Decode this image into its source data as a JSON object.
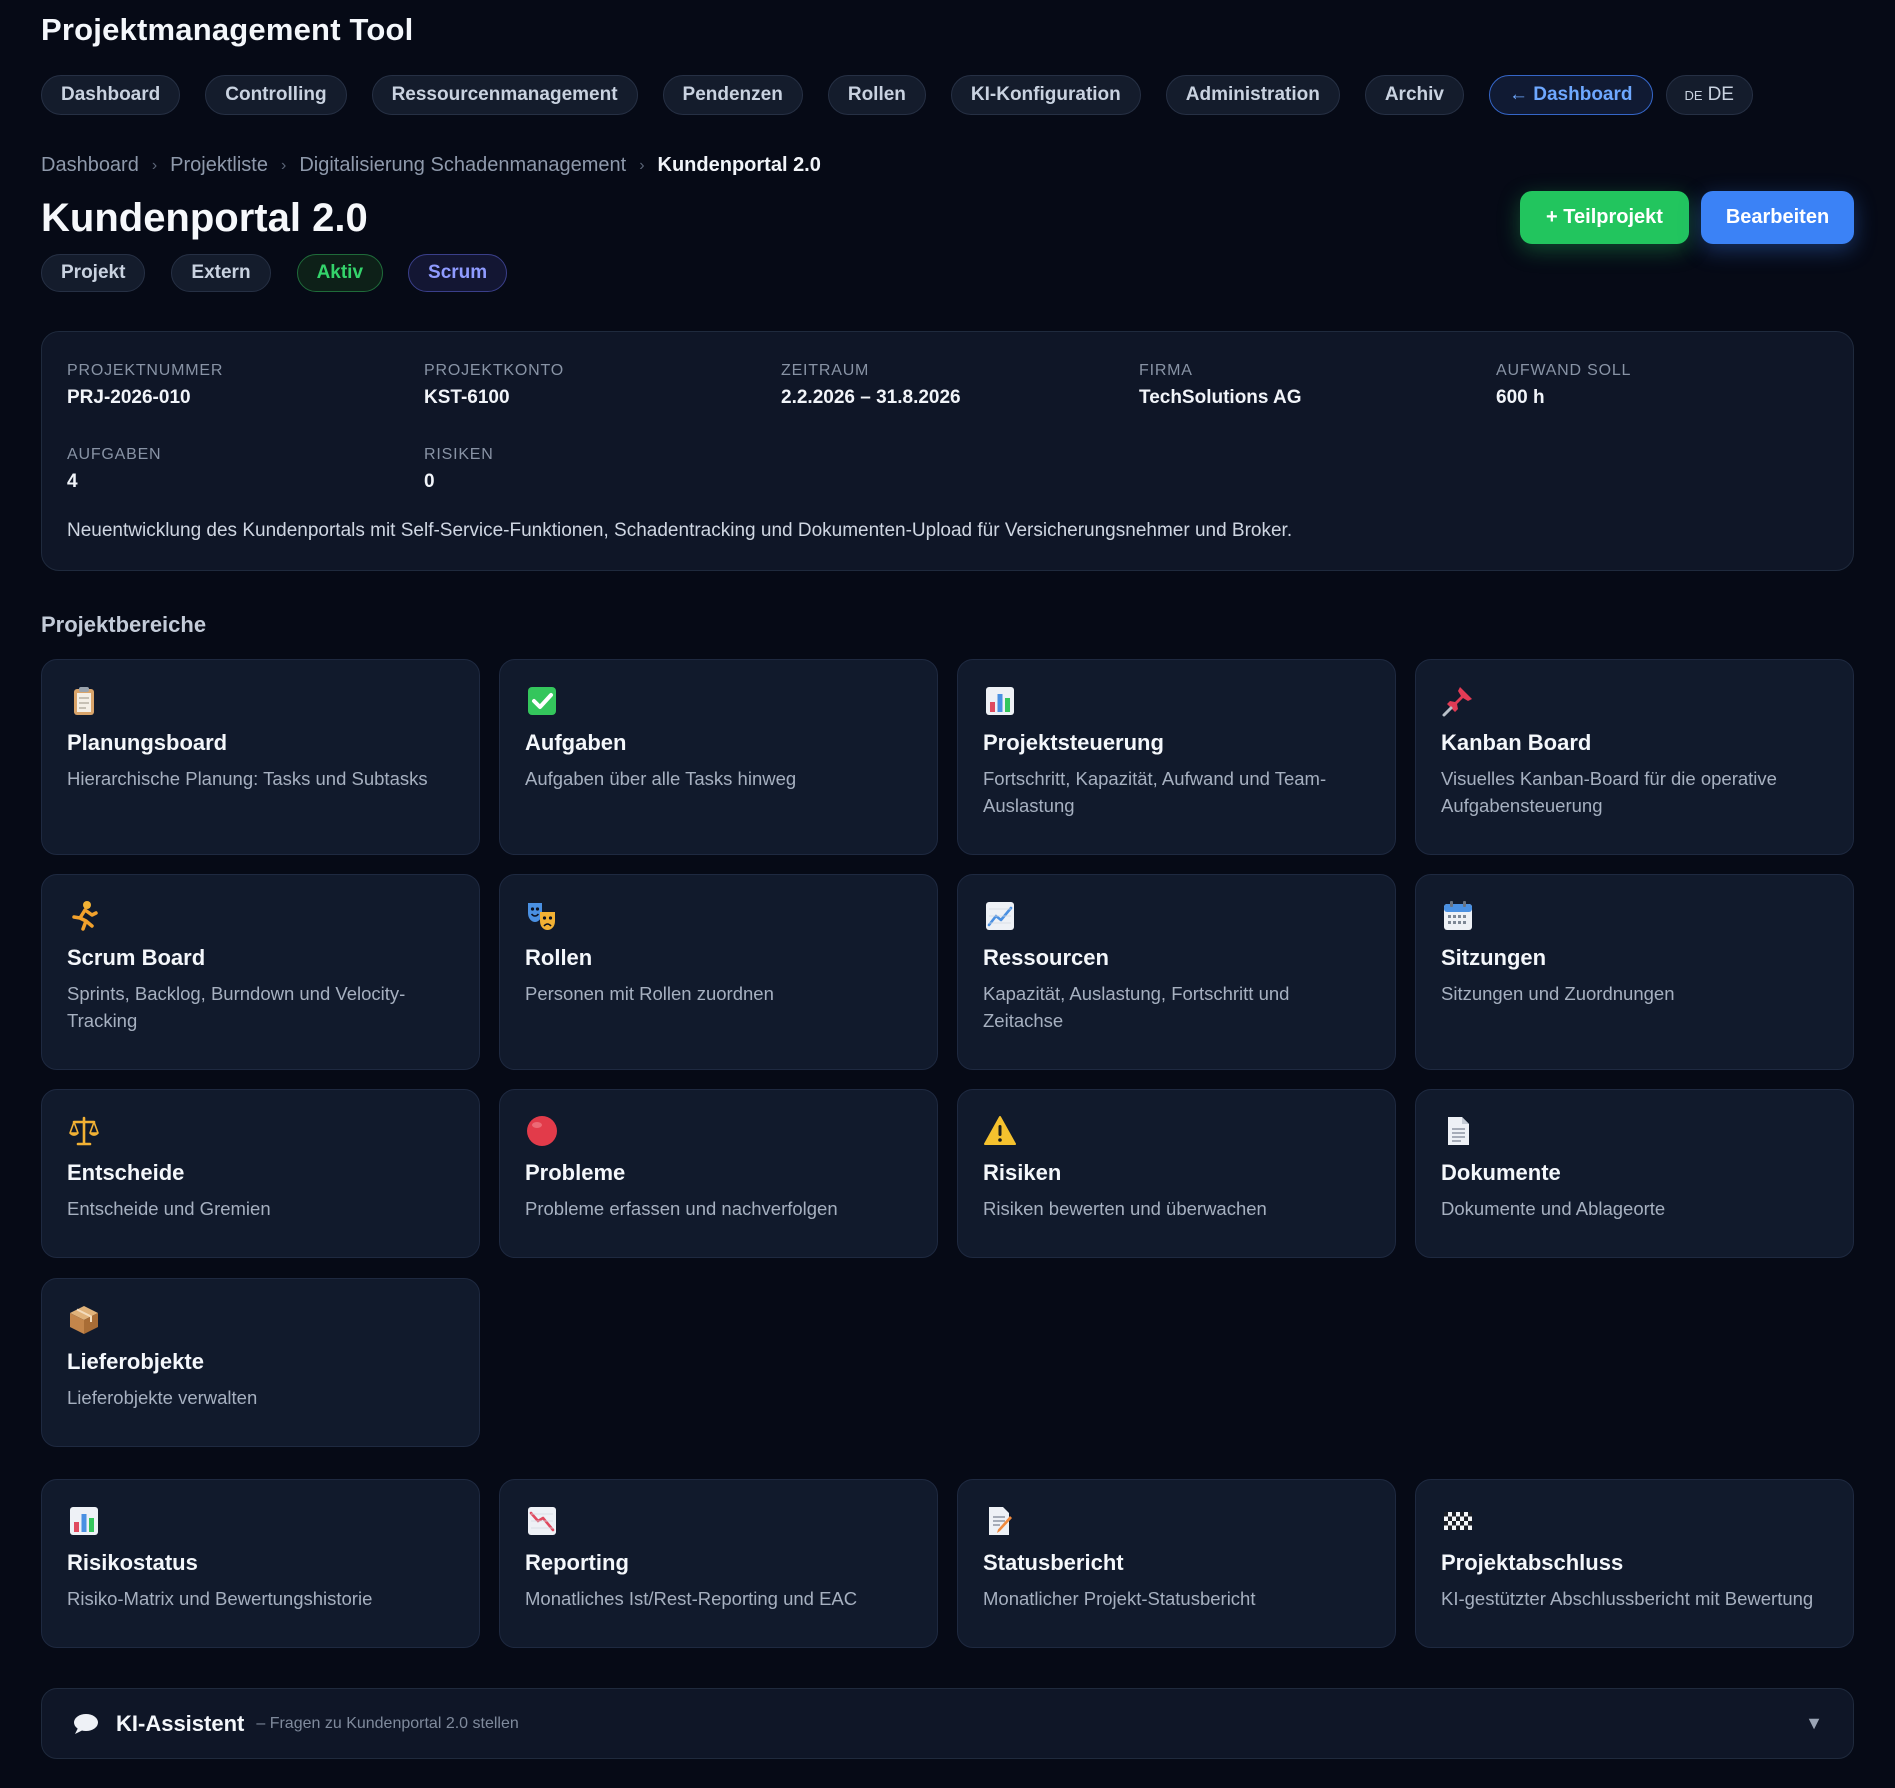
{
  "app": {
    "title": "Projektmanagement Tool"
  },
  "nav": {
    "items": [
      {
        "label": "Dashboard"
      },
      {
        "label": "Controlling"
      },
      {
        "label": "Ressourcenmanagement"
      },
      {
        "label": "Pendenzen"
      },
      {
        "label": "Rollen"
      },
      {
        "label": "KI-Konfiguration"
      },
      {
        "label": "Administration"
      },
      {
        "label": "Archiv"
      }
    ],
    "back_label": "← Dashboard",
    "lang_flag": "DE",
    "lang_label": "DE"
  },
  "breadcrumb": [
    "Dashboard",
    "Projektliste",
    "Digitalisierung Schadenmanagement",
    "Kundenportal 2.0"
  ],
  "page": {
    "title": "Kundenportal 2.0"
  },
  "actions": {
    "add_subproject": "+ Teilprojekt",
    "edit": "Bearbeiten"
  },
  "tags": [
    "Projekt",
    "Extern",
    "Aktiv",
    "Scrum"
  ],
  "info": {
    "fields": [
      {
        "label": "PROJEKTNUMMER",
        "value": "PRJ-2026-010"
      },
      {
        "label": "PROJEKTKONTO",
        "value": "KST-6100"
      },
      {
        "label": "ZEITRAUM",
        "value": "2.2.2026 – 31.8.2026"
      },
      {
        "label": "FIRMA",
        "value": "TechSolutions AG"
      },
      {
        "label": "AUFWAND SOLL",
        "value": "600 h"
      },
      {
        "label": "AUFGABEN",
        "value": "4"
      },
      {
        "label": "RISIKEN",
        "value": "0"
      }
    ],
    "description": "Neuentwicklung des Kundenportals mit Self-Service-Funktionen, Schadentracking und Dokumenten-Upload für Versicherungsnehmer und Broker."
  },
  "section_title": "Projektbereiche",
  "cards": [
    {
      "icon": "clipboard-icon",
      "title": "Planungsboard",
      "desc": "Hierarchische Planung: Tasks und Subtasks"
    },
    {
      "icon": "checkmark-icon",
      "title": "Aufgaben",
      "desc": "Aufgaben über alle Tasks hinweg"
    },
    {
      "icon": "bar-chart-icon",
      "title": "Projektsteuerung",
      "desc": "Fortschritt, Kapazität, Aufwand und Team-Auslastung"
    },
    {
      "icon": "pushpin-icon",
      "title": "Kanban Board",
      "desc": "Visuelles Kanban-Board für die operative Aufgabensteuerung"
    },
    {
      "icon": "runner-icon",
      "title": "Scrum Board",
      "desc": "Sprints, Backlog, Burndown und Velocity-Tracking"
    },
    {
      "icon": "masks-icon",
      "title": "Rollen",
      "desc": "Personen mit Rollen zuordnen"
    },
    {
      "icon": "trend-chart-icon",
      "title": "Ressourcen",
      "desc": "Kapazität, Auslastung, Fortschritt und Zeitachse"
    },
    {
      "icon": "calendar-icon",
      "title": "Sitzungen",
      "desc": "Sitzungen und Zuordnungen"
    },
    {
      "icon": "scales-icon",
      "title": "Entscheide",
      "desc": "Entscheide und Gremien"
    },
    {
      "icon": "red-circle-icon",
      "title": "Probleme",
      "desc": "Probleme erfassen und nachverfolgen"
    },
    {
      "icon": "warning-icon",
      "title": "Risiken",
      "desc": "Risiken bewerten und überwachen"
    },
    {
      "icon": "document-icon",
      "title": "Dokumente",
      "desc": "Dokumente und Ablageorte"
    },
    {
      "icon": "package-icon",
      "title": "Lieferobjekte",
      "desc": "Lieferobjekte verwalten"
    },
    {
      "icon": "bar-chart-icon",
      "title": "Risikostatus",
      "desc": "Risiko-Matrix und Bewertungshistorie"
    },
    {
      "icon": "down-chart-icon",
      "title": "Reporting",
      "desc": "Monatliches Ist/Rest-Reporting und EAC"
    },
    {
      "icon": "memo-icon",
      "title": "Statusbericht",
      "desc": "Monatlicher Projekt-Statusbericht"
    },
    {
      "icon": "checkered-flag-icon",
      "title": "Projektabschluss",
      "desc": "KI-gestützter Abschlussbericht mit Bewertung"
    }
  ],
  "ki": {
    "title": "KI-Assistent",
    "subtitle": "– Fragen zu Kundenportal 2.0 stellen"
  },
  "colors": {
    "background": "#060a16",
    "card": "#111a2c",
    "green": "#22c55e",
    "blue": "#3b82f6",
    "accent": "#6ea8ff"
  }
}
